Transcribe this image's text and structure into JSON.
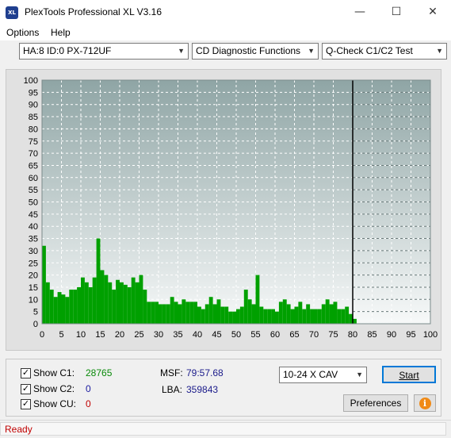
{
  "window": {
    "title": "PlexTools Professional XL V3.16",
    "app_icon_text": "XL",
    "minimize": "—",
    "maximize": "☐",
    "close": "✕"
  },
  "menu": {
    "options": "Options",
    "help": "Help"
  },
  "toolbar": {
    "drive": "HA:8 ID:0  PX-712UF",
    "function": "CD Diagnostic Functions",
    "test": "Q-Check C1/C2 Test"
  },
  "chart_data": {
    "type": "bar",
    "title": "",
    "xlabel": "",
    "ylabel": "",
    "xlim": [
      0,
      100
    ],
    "ylim": [
      0,
      100
    ],
    "x_ticks": [
      0,
      5,
      10,
      15,
      20,
      25,
      30,
      35,
      40,
      45,
      50,
      55,
      60,
      65,
      70,
      75,
      80,
      85,
      90,
      95,
      100
    ],
    "y_ticks": [
      0,
      5,
      10,
      15,
      20,
      25,
      30,
      35,
      40,
      45,
      50,
      55,
      60,
      65,
      70,
      75,
      80,
      85,
      90,
      95,
      100
    ],
    "disc_end_marker": 80,
    "grid": true,
    "series": [
      {
        "name": "C1",
        "color": "#00a000",
        "x": [
          0,
          1,
          2,
          3,
          4,
          5,
          6,
          7,
          8,
          9,
          10,
          11,
          12,
          13,
          14,
          15,
          16,
          17,
          18,
          19,
          20,
          21,
          22,
          23,
          24,
          25,
          26,
          27,
          28,
          29,
          30,
          31,
          32,
          33,
          34,
          35,
          36,
          37,
          38,
          39,
          40,
          41,
          42,
          43,
          44,
          45,
          46,
          47,
          48,
          49,
          50,
          51,
          52,
          53,
          54,
          55,
          56,
          57,
          58,
          59,
          60,
          61,
          62,
          63,
          64,
          65,
          66,
          67,
          68,
          69,
          70,
          71,
          72,
          73,
          74,
          75,
          76,
          77,
          78,
          79,
          80
        ],
        "values": [
          32,
          17,
          14,
          11,
          13,
          12,
          11,
          14,
          14,
          15,
          19,
          17,
          15,
          19,
          35,
          22,
          20,
          17,
          14,
          18,
          17,
          16,
          15,
          19,
          17,
          20,
          14,
          9,
          9,
          9,
          8,
          8,
          8,
          11,
          9,
          8,
          10,
          9,
          9,
          9,
          7,
          6,
          8,
          11,
          8,
          10,
          7,
          7,
          5,
          5,
          6,
          7,
          14,
          10,
          8,
          20,
          7,
          6,
          6,
          6,
          5,
          9,
          10,
          8,
          6,
          7,
          9,
          6,
          8,
          6,
          6,
          6,
          8,
          10,
          8,
          9,
          6,
          6,
          7,
          4,
          2
        ]
      }
    ]
  },
  "stats": {
    "c1_label": "Show C1:",
    "c1_value": "28765",
    "c2_label": "Show C2:",
    "c2_value": "0",
    "cu_label": "Show CU:",
    "cu_value": "0",
    "msf_label": "MSF:",
    "msf_value": "79:57.68",
    "lba_label": "LBA:",
    "lba_value": "359843",
    "speed": "10-24 X CAV",
    "start": "Start",
    "preferences": "Preferences",
    "info_icon": "i",
    "check": "✓"
  },
  "status": "Ready"
}
